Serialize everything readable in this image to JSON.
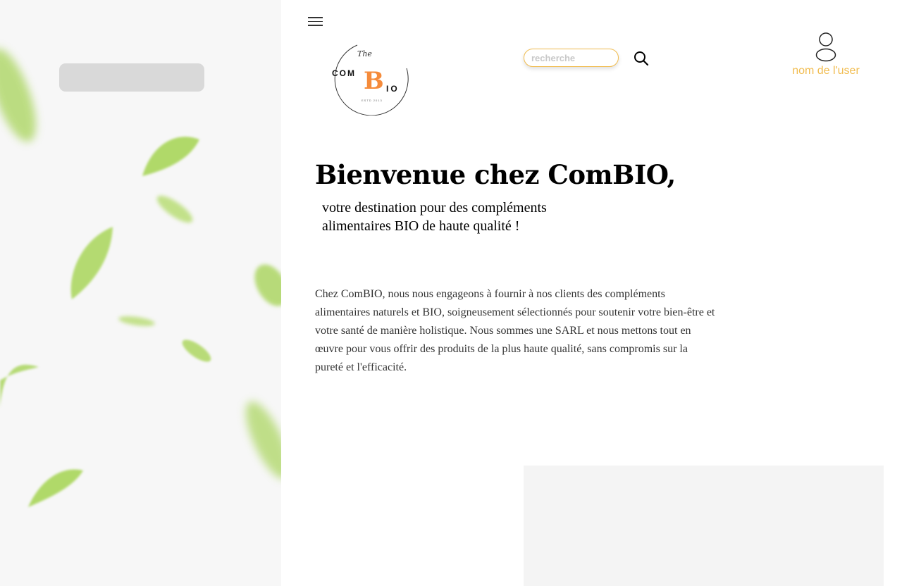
{
  "header": {
    "menu_icon": "hamburger-menu-icon",
    "logo": {
      "top_text": "The",
      "left_text": "COM",
      "center_letter": "B",
      "right_text": "IO",
      "est_text": "ESTD 2013",
      "accent_color": "#f58b3b"
    },
    "search": {
      "placeholder": "recherche",
      "icon": "search-icon"
    },
    "user": {
      "icon": "user-icon",
      "name": "nom de l'user",
      "color": "#f1bc4f"
    }
  },
  "hero": {
    "title": "Bienvenue chez ComBIO,",
    "subtitle_line1": "votre destination pour des compléments",
    "subtitle_line2": "alimentaires BIO de haute qualité !",
    "body": "Chez ComBIO, nous nous engageons à fournir à nos clients des compléments alimentaires naturels et BIO, soigneusement sélectionnés pour soutenir votre bien-être et votre santé de manière holistique. Nous sommes une SARL et nous mettons tout en œuvre pour vous offrir des produits de la plus haute qualité, sans compromis sur la pureté et l'efficacité."
  },
  "colors": {
    "accent": "#f1bc4f",
    "leaf": "#a9d65a",
    "panel_bg": "#f7f7f7"
  }
}
